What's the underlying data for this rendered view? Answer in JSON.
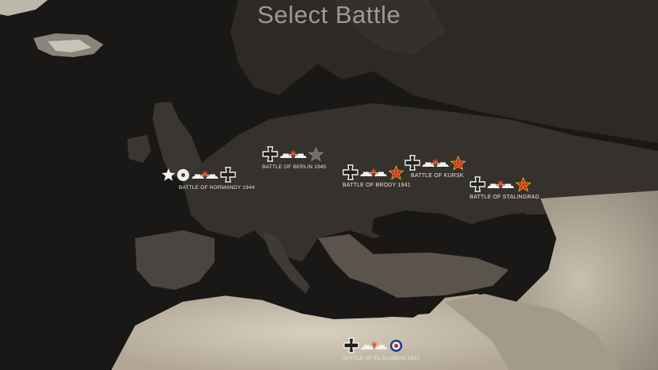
{
  "screen": {
    "title": "Select Battle"
  },
  "battles": [
    {
      "label": "BATTLE OF NORMANDY 1944",
      "factions": [
        "usa",
        "uk",
        "germany"
      ]
    },
    {
      "label": "BATTLE OF BERLIN 1945",
      "factions": [
        "germany",
        "soviet"
      ],
      "locked_faction": "soviet"
    },
    {
      "label": "BATTLE OF BRODY 1941",
      "factions": [
        "germany",
        "soviet"
      ]
    },
    {
      "label": "BATTLE OF KURSK",
      "factions": [
        "germany",
        "soviet"
      ]
    },
    {
      "label": "BATTLE OF STALINGRAD",
      "factions": [
        "germany",
        "soviet"
      ]
    },
    {
      "label": "BATTLE OF EL ALAMEIN 1942",
      "factions": [
        "germany",
        "uk"
      ]
    }
  ],
  "colors": {
    "title": "#9a9a9a",
    "sea": "#1a1816",
    "land_dark": "#2f2b27",
    "desert": "#c9bfae",
    "soviet_red": "#c8281e",
    "soviet_gold": "#f0c020",
    "uk_roundel_blue": "#1b3d8a",
    "uk_roundel_red": "#c8281e",
    "icon_white": "#f2f2f2"
  },
  "icons": {
    "germany": "iron-cross-icon",
    "soviet": "red-star-icon",
    "usa": "white-star-icon",
    "uk": "roundel-icon",
    "battle": "tank-vs-tank-icon"
  }
}
